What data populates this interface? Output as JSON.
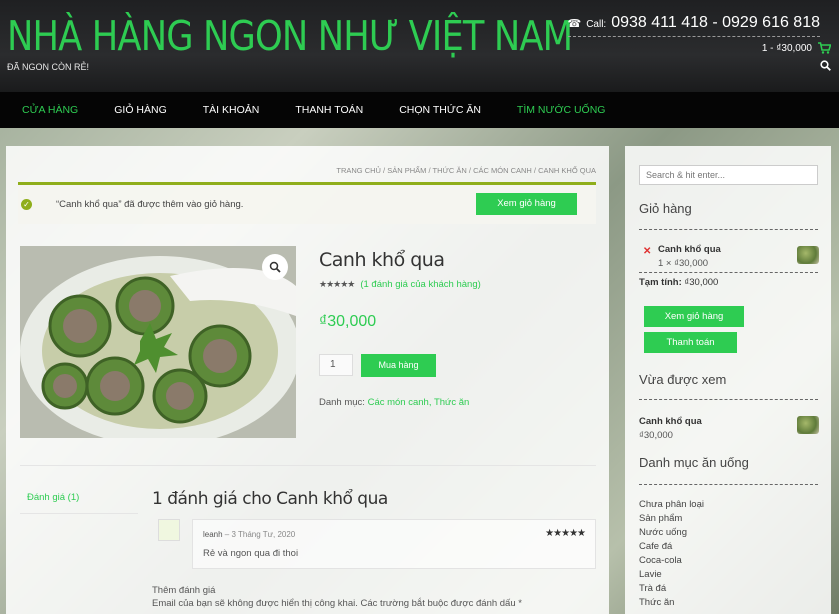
{
  "header": {
    "site_title": "NHÀ HÀNG NGON NHƯ VIỆT NAM",
    "tagline": "ĐÃ NGON CÒN RẺ!",
    "phone_label": "Call:",
    "phone_numbers": "0938 411 418 - 0929 616 818",
    "cart_summary": "1 - ₫30,000"
  },
  "nav": {
    "items": [
      "CỬA HÀNG",
      "GIỎ HÀNG",
      "TÀI KHOẢN",
      "THANH TOÁN",
      "CHỌN THỨC ĂN",
      "TÌM NƯỚC UỐNG"
    ]
  },
  "main": {
    "breadcrumb": "TRANG CHỦ / SẢN PHẨM / THỨC ĂN / CÁC MÓN CANH / CANH KHỔ QUA",
    "notice_text": "“Canh khổ qua” đã được thêm vào giỏ hàng.",
    "notice_button": "Xem giỏ hàng",
    "product_title": "Canh khổ qua",
    "stars": "★★★★★",
    "rating_link": "(1 đánh giá của khách hàng)",
    "price": "₫30,000",
    "quantity": "1",
    "add_to_cart": "Mua hàng",
    "categories_label": "Danh mục: ",
    "categories_links": "Các món canh, Thức ăn",
    "tab_reviews": "Đánh giá (1)",
    "reviews_title": "1 đánh giá cho Canh khổ qua",
    "review": {
      "author": "leanh",
      "date": " – 3 Tháng Tư, 2020",
      "text": "Rẻ và ngon qua đi thoi",
      "stars": "★★★★★"
    },
    "add_review_label": "Thêm đánh giá",
    "email_note": "Email của bạn sẽ không được hiển thị công khai. Các trường bắt buộc được đánh dấu *"
  },
  "sidebar": {
    "search_placeholder": "Search & hit enter...",
    "cart_title": "Giỏ hàng",
    "cart_item_name": "Canh khổ qua",
    "cart_item_qty": "1 × ₫30,000",
    "subtotal_label": "Tạm tính:",
    "subtotal_value": " ₫30,000",
    "view_cart_button": "Xem giỏ hàng",
    "checkout_button": "Thanh toán",
    "recent_title": "Vừa được xem",
    "recent_name": "Canh khổ qua",
    "recent_price": "₫30,000",
    "categories_title": "Danh mục ăn uống",
    "categories": [
      "Chưa phân loại",
      "Sản phẩm",
      "Nước uống",
      "Cafe đá",
      "Coca-cola",
      "Lavie",
      "Trà đá",
      "Thức ăn"
    ]
  },
  "colors": {
    "accent": "#2ecc52",
    "header_bg": "#222324",
    "nav_bg": "#050505",
    "notice_border": "#8fae1b"
  }
}
